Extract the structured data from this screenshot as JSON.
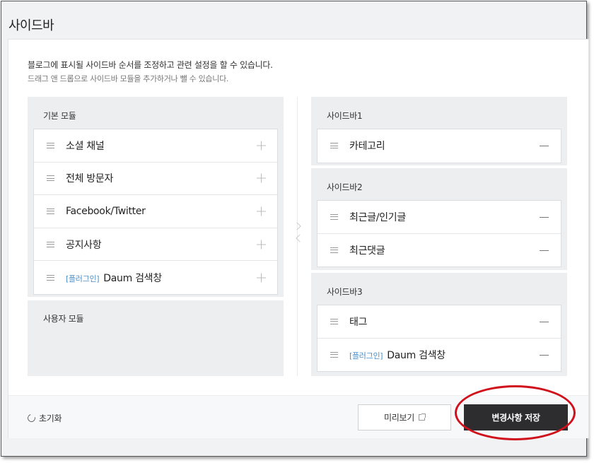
{
  "page": {
    "title": "사이드바",
    "description": "블로그에 표시될 사이드바 순서를 조정하고 관련 설정을 할 수 있습니다.",
    "sub_description": "드래그 앤 드롭으로 사이드바 모듈을 추가하거나 뺄 수 있습니다."
  },
  "left": {
    "basic_title": "기본 모듈",
    "basic_items": [
      {
        "label": "소셜 채널",
        "tag": ""
      },
      {
        "label": "전체 방문자",
        "tag": ""
      },
      {
        "label": "Facebook/Twitter",
        "tag": ""
      },
      {
        "label": "공지사항",
        "tag": ""
      },
      {
        "label": "Daum 검색창",
        "tag": "[플러그인]"
      }
    ],
    "user_title": "사용자 모듈"
  },
  "right": {
    "sidebars": [
      {
        "title": "사이드바1",
        "items": [
          {
            "label": "카테고리",
            "tag": ""
          }
        ]
      },
      {
        "title": "사이드바2",
        "items": [
          {
            "label": "최근글/인기글",
            "tag": ""
          },
          {
            "label": "최근댓글",
            "tag": ""
          }
        ]
      },
      {
        "title": "사이드바3",
        "items": [
          {
            "label": "태그",
            "tag": ""
          },
          {
            "label": "Daum 검색창",
            "tag": "[플러그인]"
          }
        ]
      }
    ]
  },
  "footer": {
    "reset_label": "초기화",
    "preview_label": "미리보기",
    "save_label": "변경사항 저장"
  },
  "colors": {
    "accent_tag": "#4a90c9",
    "save_bg": "#2d2d2f",
    "annotation": "#d0101a"
  }
}
